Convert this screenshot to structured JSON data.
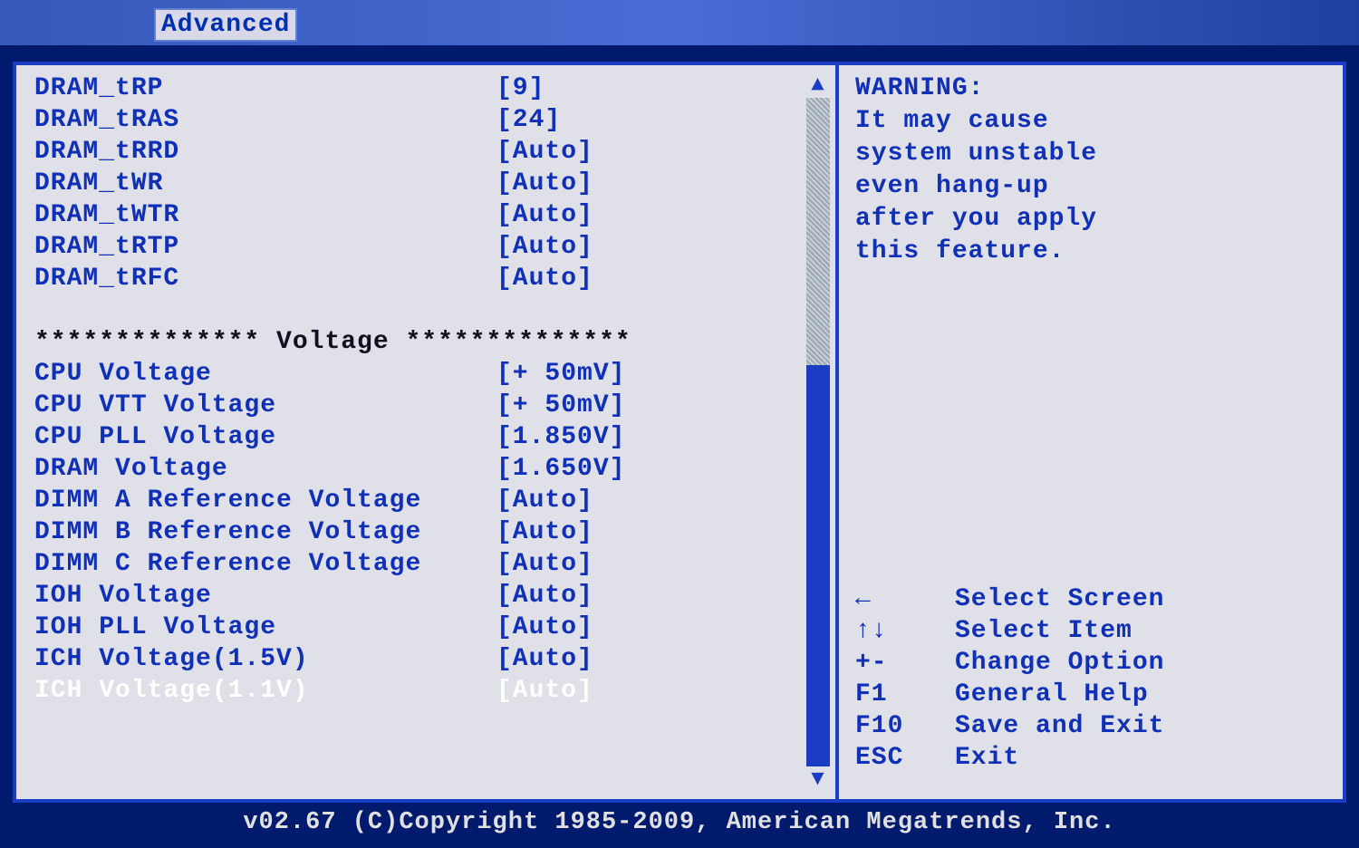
{
  "tab": "Advanced",
  "settings": [
    {
      "label": "DRAM_tRP",
      "value": "[9]",
      "selected": false
    },
    {
      "label": "DRAM_tRAS",
      "value": "[24]",
      "selected": false
    },
    {
      "label": "DRAM_tRRD",
      "value": "[Auto]",
      "selected": false
    },
    {
      "label": "DRAM_tWR",
      "value": "[Auto]",
      "selected": false
    },
    {
      "label": "DRAM_tWTR",
      "value": "[Auto]",
      "selected": false
    },
    {
      "label": "DRAM_tRTP",
      "value": "[Auto]",
      "selected": false
    },
    {
      "label": "DRAM_tRFC",
      "value": "[Auto]",
      "selected": false
    }
  ],
  "section_header": "  ************** Voltage **************",
  "voltage_settings": [
    {
      "label": "CPU Voltage",
      "value": "[+ 50mV]",
      "selected": false
    },
    {
      "label": "CPU VTT Voltage",
      "value": "[+ 50mV]",
      "selected": false
    },
    {
      "label": "CPU PLL Voltage",
      "value": "[1.850V]",
      "selected": false
    },
    {
      "label": "DRAM Voltage",
      "value": "[1.650V]",
      "selected": false
    },
    {
      "label": "DIMM A Reference Voltage",
      "value": "[Auto]",
      "selected": false
    },
    {
      "label": "DIMM B Reference Voltage",
      "value": "[Auto]",
      "selected": false
    },
    {
      "label": "DIMM C Reference Voltage",
      "value": "[Auto]",
      "selected": false
    },
    {
      "label": "IOH Voltage",
      "value": "[Auto]",
      "selected": false
    },
    {
      "label": "IOH PLL Voltage",
      "value": "[Auto]",
      "selected": false
    },
    {
      "label": "ICH Voltage(1.5V)",
      "value": "[Auto]",
      "selected": false
    },
    {
      "label": "ICH Voltage(1.1V)",
      "value": "[Auto]",
      "selected": true
    }
  ],
  "help": {
    "warning_title": "WARNING:",
    "warning_lines": [
      "It may cause",
      "system unstable",
      "even hang-up",
      "after you apply",
      "this feature."
    ]
  },
  "keys": [
    {
      "key": "←",
      "desc": "Select Screen"
    },
    {
      "key": "↑↓",
      "desc": "Select Item"
    },
    {
      "key": "+-",
      "desc": "Change Option"
    },
    {
      "key": "F1",
      "desc": "General Help"
    },
    {
      "key": "F10",
      "desc": "Save and Exit"
    },
    {
      "key": "ESC",
      "desc": "Exit"
    }
  ],
  "footer": "v02.67 (C)Copyright 1985-2009, American Megatrends, Inc."
}
